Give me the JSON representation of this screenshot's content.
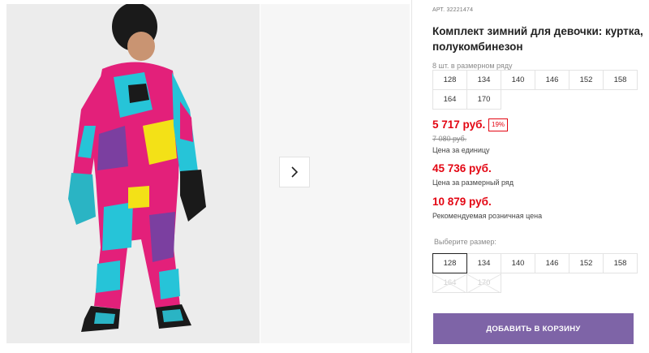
{
  "gallery": {
    "next_icon": "chevron-right-icon"
  },
  "product": {
    "art_label": "АРТ.",
    "art_number": "32221474",
    "title": "Комплект зимний для девочки: куртка, полукомбинезон"
  },
  "size_grid": {
    "caption": "8 шт. в размерном ряду",
    "sizes": [
      "128",
      "134",
      "140",
      "146",
      "152",
      "158",
      "164",
      "170"
    ]
  },
  "pricing": {
    "unit_price": "5 717 руб.",
    "discount": "19%",
    "old_price": "7 080 руб.",
    "unit_label": "Цена за единицу",
    "row_price": "45 736 руб.",
    "row_label": "Цена за размерный ряд",
    "retail_price": "10 879 руб.",
    "retail_label": "Рекомендуемая розничная цена"
  },
  "size_select": {
    "label": "Выберите размер:",
    "options": [
      "128",
      "134",
      "140",
      "146",
      "152",
      "158",
      "164",
      "170"
    ],
    "selected": "128",
    "disabled": [
      "164",
      "170"
    ]
  },
  "cart": {
    "button_label": "ДОБАВИТЬ В КОРЗИНУ"
  },
  "colors": {
    "accent": "#7e64a7",
    "price_red": "#e30613"
  }
}
